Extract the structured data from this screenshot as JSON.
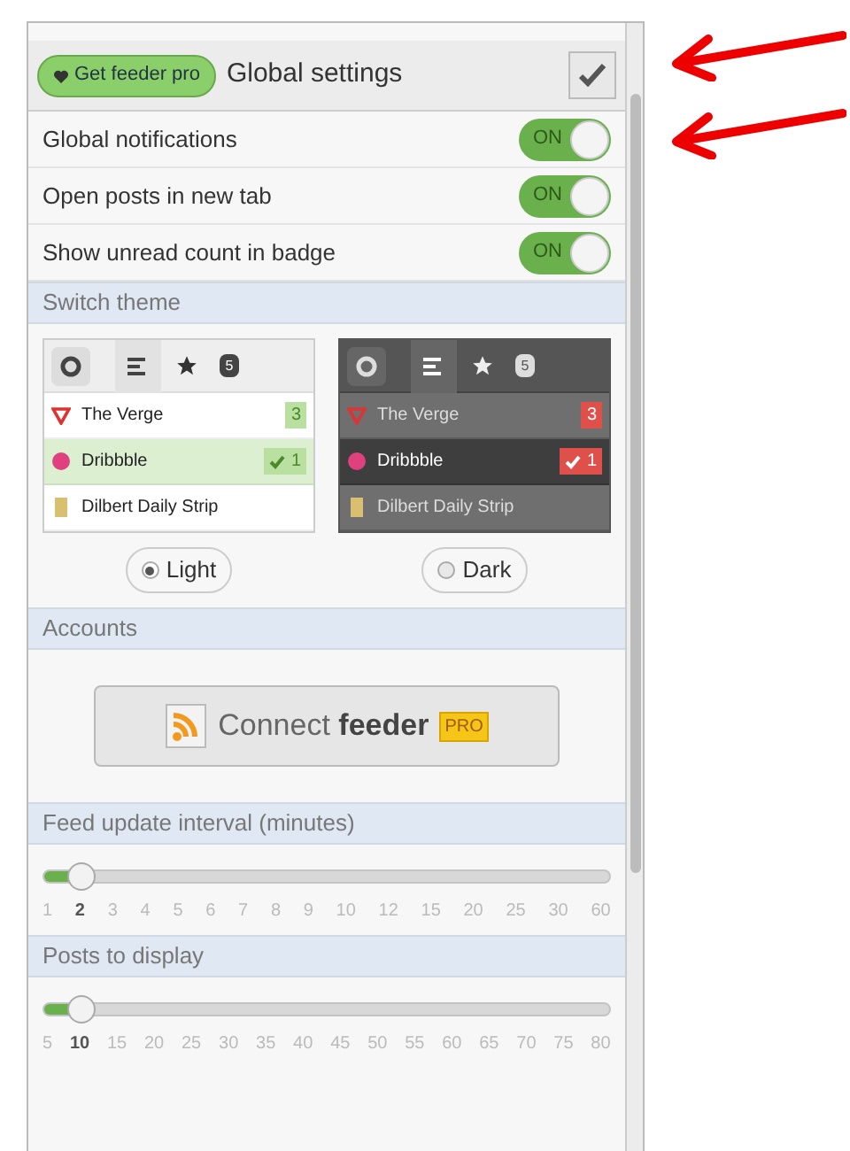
{
  "header": {
    "pro_button": "Get feeder pro",
    "title": "Global settings"
  },
  "toggles": [
    {
      "label": "Global notifications",
      "on": true,
      "state_text": "ON"
    },
    {
      "label": "Open posts in new tab",
      "on": true,
      "state_text": "ON"
    },
    {
      "label": "Show unread count in badge",
      "on": true,
      "state_text": "ON"
    }
  ],
  "theme_section": {
    "title": "Switch theme",
    "themes": [
      {
        "kind": "light",
        "option": "Light",
        "selected": true,
        "tab_badge": "5",
        "feeds": [
          {
            "name": "The Verge",
            "count": "3",
            "highlighted": false
          },
          {
            "name": "Dribbble",
            "count": "1",
            "highlighted": true
          },
          {
            "name": "Dilbert Daily Strip",
            "highlighted": false
          }
        ]
      },
      {
        "kind": "dark",
        "option": "Dark",
        "selected": false,
        "tab_badge": "5",
        "feeds": [
          {
            "name": "The Verge",
            "count": "3",
            "highlighted": false
          },
          {
            "name": "Dribbble",
            "count": "1",
            "highlighted": true
          },
          {
            "name": "Dilbert Daily Strip",
            "highlighted": false
          }
        ]
      }
    ]
  },
  "accounts": {
    "title": "Accounts",
    "connect_prefix": "Connect",
    "connect_brand": "feeder",
    "connect_badge": "PRO"
  },
  "sliders": [
    {
      "title": "Feed update interval (minutes)",
      "level": 0.067,
      "ticks": [
        {
          "label": "1",
          "selected": false
        },
        {
          "label": "2",
          "selected": true
        },
        {
          "label": "3",
          "selected": false
        },
        {
          "label": "4",
          "selected": false
        },
        {
          "label": "5",
          "selected": false
        },
        {
          "label": "6",
          "selected": false
        },
        {
          "label": "7",
          "selected": false
        },
        {
          "label": "8",
          "selected": false
        },
        {
          "label": "9",
          "selected": false
        },
        {
          "label": "10",
          "selected": false
        },
        {
          "label": "12",
          "selected": false
        },
        {
          "label": "15",
          "selected": false
        },
        {
          "label": "20",
          "selected": false
        },
        {
          "label": "25",
          "selected": false
        },
        {
          "label": "30",
          "selected": false
        },
        {
          "label": "60",
          "selected": false
        }
      ]
    },
    {
      "title": "Posts to display",
      "level": 0.067,
      "ticks": [
        {
          "label": "5",
          "selected": false
        },
        {
          "label": "10",
          "selected": true
        },
        {
          "label": "15",
          "selected": false
        },
        {
          "label": "20",
          "selected": false
        },
        {
          "label": "25",
          "selected": false
        },
        {
          "label": "30",
          "selected": false
        },
        {
          "label": "35",
          "selected": false
        },
        {
          "label": "40",
          "selected": false
        },
        {
          "label": "45",
          "selected": false
        },
        {
          "label": "50",
          "selected": false
        },
        {
          "label": "55",
          "selected": false
        },
        {
          "label": "60",
          "selected": false
        },
        {
          "label": "65",
          "selected": false
        },
        {
          "label": "70",
          "selected": false
        },
        {
          "label": "75",
          "selected": false
        },
        {
          "label": "80",
          "selected": false
        }
      ]
    }
  ]
}
